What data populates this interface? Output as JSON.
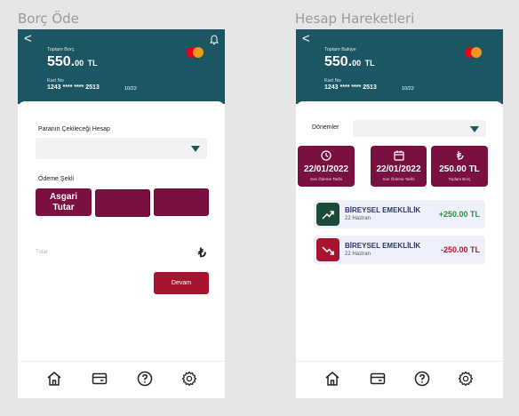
{
  "left": {
    "frame_title": "Borç Öde",
    "header": {
      "back": "<",
      "total_label": "Toplam Borç",
      "amount": "550.",
      "amount_decimals": "00",
      "currency": "TL",
      "card_no_label": "Kart No",
      "card_no": "1243 **** **** 2513",
      "expiry": "10/22"
    },
    "account_label": "Paranın Çekileceği Hesap",
    "payment_type_label": "Ödeme Şekli",
    "options": [
      {
        "label": "Asgari\nTutar"
      },
      {
        "label": ""
      },
      {
        "label": ""
      }
    ],
    "amount_placeholder": "Tutar",
    "lira_symbol": "₺",
    "continue_label": "Devam"
  },
  "right": {
    "frame_title": "Hesap Hareketleri",
    "header": {
      "back": "<",
      "total_label": "Toplam Bakiye",
      "amount": "550.",
      "amount_decimals": "00",
      "currency": "TL",
      "card_no_label": "Kart No",
      "card_no": "1243 **** **** 2513",
      "expiry": "10/22"
    },
    "period_label": "Dönemler",
    "stats": [
      {
        "value": "22/01/2022",
        "label": "Son Ödeme Tarihi",
        "icon": "clock-icon"
      },
      {
        "value": "22/01/2022",
        "label": "Son Ödeme Tarihi",
        "icon": "calendar-icon"
      },
      {
        "value": "250.00 TL",
        "label": "Toplam Borç",
        "icon": "lira-icon"
      }
    ],
    "transactions": [
      {
        "title": "BİREYSEL EMEKLİLİK",
        "date": "22 Haziran",
        "amount": "+250.00 TL",
        "color": "#2e8b3e",
        "icon_bg": "#1d4b3a",
        "icon": "trend-up-icon"
      },
      {
        "title": "BİREYSEL EMEKLİLİK",
        "date": "22 Haziran",
        "amount": "-250.00 TL",
        "color": "#c0142a",
        "icon_bg": "#a8142f",
        "icon": "trend-down-icon"
      }
    ]
  },
  "nav": [
    "home-icon",
    "wallet-icon",
    "help-icon",
    "settings-icon"
  ],
  "colors": {
    "header": "#1d5663",
    "primary": "#7a1042",
    "accent": "#a8142f"
  }
}
